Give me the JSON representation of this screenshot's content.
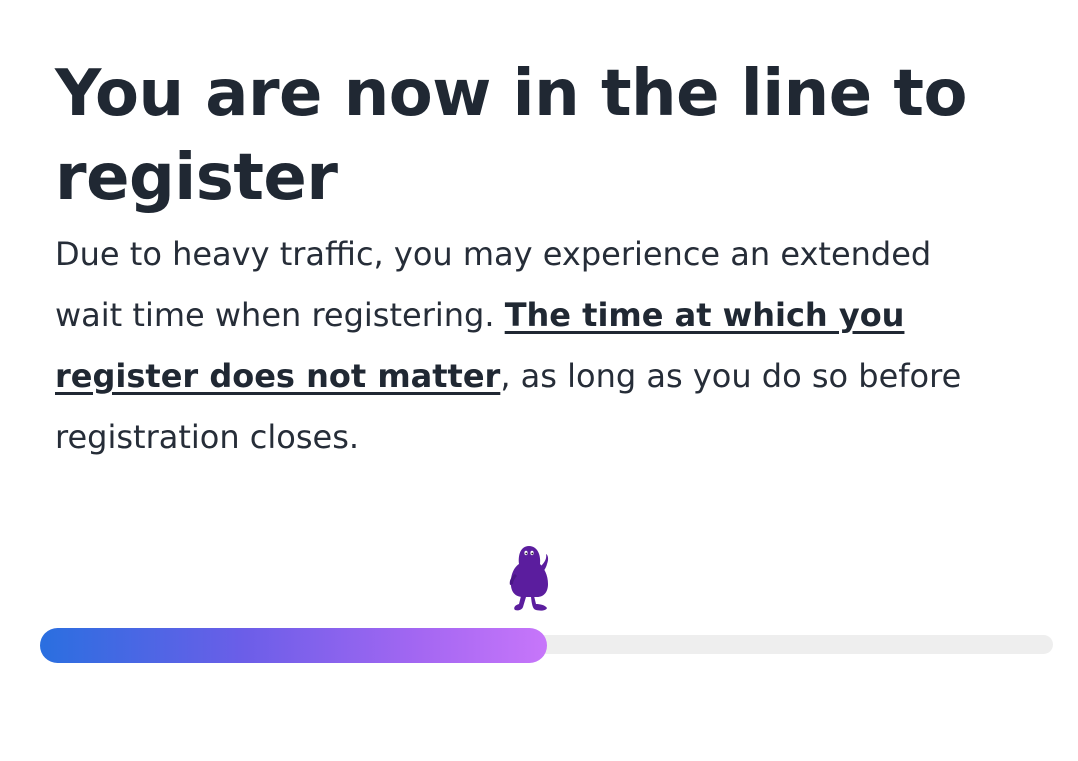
{
  "heading": "You are now in the line to register",
  "message": {
    "before": "Due to heavy traffic, you may experience an extended wait time when registering. ",
    "emphasis": "The time at which you register does not matter",
    "after": ", as long as you do so before registration closes."
  },
  "progress": {
    "fraction": 0.5,
    "fill_gradient": [
      "#2a6fe0",
      "#6b5ee8",
      "#a467f2",
      "#c776fa"
    ],
    "track_color": "#eeeeee"
  },
  "mascot": {
    "icon": "purple-mascot-icon",
    "color": "#5b1d9e"
  }
}
